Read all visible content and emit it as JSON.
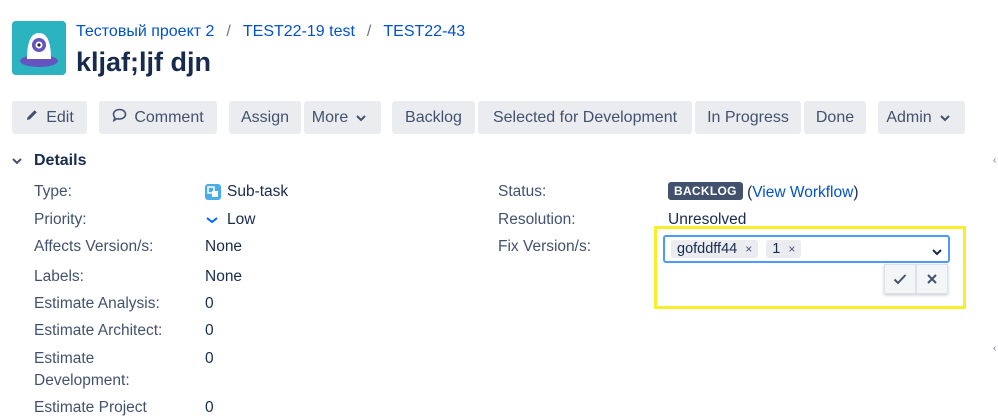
{
  "breadcrumbs": [
    "Тестовый проект 2",
    "TEST22-19 test",
    "TEST22-43"
  ],
  "breadcrumb_separator": "/",
  "issue_title": "kljaf;ljf djn",
  "toolbar": {
    "edit": "Edit",
    "comment": "Comment",
    "assign": "Assign",
    "more": "More",
    "backlog": "Backlog",
    "selected_for_development": "Selected for Development",
    "in_progress": "In Progress",
    "done": "Done",
    "admin": "Admin"
  },
  "details": {
    "heading": "Details",
    "fields": {
      "type": {
        "label": "Type:",
        "value": "Sub-task"
      },
      "priority": {
        "label": "Priority:",
        "value": "Low"
      },
      "affects_version": {
        "label": "Affects Version/s:",
        "value": "None"
      },
      "labels": {
        "label": "Labels:",
        "value": "None"
      },
      "estimate_analysis": {
        "label": "Estimate Analysis:",
        "value": "0"
      },
      "estimate_architect": {
        "label": "Estimate Architect:",
        "value": "0"
      },
      "estimate_development": {
        "label_line1": "Estimate",
        "label_line2": "Development:",
        "value": "0"
      },
      "estimate_project": {
        "label": "Estimate Project",
        "value": "0"
      }
    },
    "right_fields": {
      "status": {
        "label": "Status:",
        "badge": "BACKLOG",
        "link_open": "(",
        "link": "View Workflow",
        "link_close": ")"
      },
      "resolution": {
        "label": "Resolution:",
        "value": "Unresolved"
      },
      "fix_version": {
        "label": "Fix Version/s:",
        "tags": [
          "gofddff44",
          "1"
        ],
        "remove_glyph": "×"
      }
    }
  },
  "colors": {
    "link": "#0052cc",
    "highlight": "#f5f02a",
    "badge": "#42526e",
    "focus": "#4c9aff"
  },
  "icons": [
    "project-avatar-icon",
    "pencil-icon",
    "comment-icon",
    "chevron-down-icon",
    "subtask-icon",
    "priority-low-icon",
    "check-icon",
    "close-icon"
  ]
}
